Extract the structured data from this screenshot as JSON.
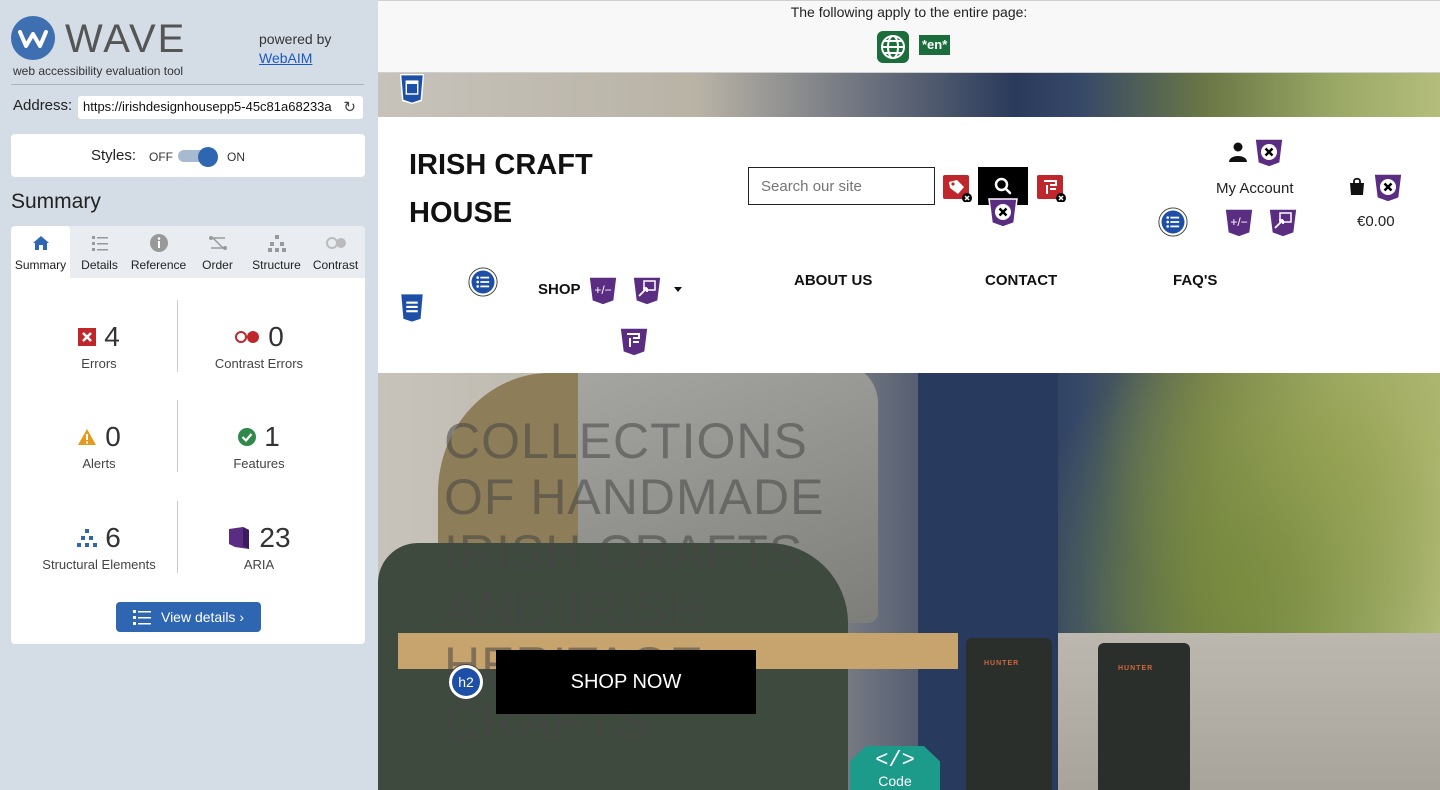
{
  "wave": {
    "logo_text": "WAVE",
    "tagline": "web accessibility evaluation tool",
    "powered_by": "powered by",
    "webaim_link": "WebAIM",
    "address_label": "Address:",
    "address_value": "https://irishdesignhousepp5-45c81a68233a",
    "styles_label": "Styles:",
    "styles_off": "OFF",
    "styles_on": "ON",
    "summary_title": "Summary",
    "tabs": [
      {
        "label": "Summary",
        "icon": "home-icon"
      },
      {
        "label": "Details",
        "icon": "list-icon"
      },
      {
        "label": "Reference",
        "icon": "info-icon"
      },
      {
        "label": "Order",
        "icon": "order-icon"
      },
      {
        "label": "Structure",
        "icon": "structure-icon"
      },
      {
        "label": "Contrast",
        "icon": "contrast-icon"
      }
    ],
    "stats": {
      "errors": {
        "value": "4",
        "label": "Errors"
      },
      "contrast_errors": {
        "value": "0",
        "label": "Contrast Errors"
      },
      "alerts": {
        "value": "0",
        "label": "Alerts"
      },
      "features": {
        "value": "1",
        "label": "Features"
      },
      "structural": {
        "value": "6",
        "label": "Structural Elements"
      },
      "aria": {
        "value": "23",
        "label": "ARIA"
      }
    },
    "view_details": "View details ›"
  },
  "site": {
    "banner_text": "The following apply to the entire page:",
    "lang_badge": "*en*",
    "brand_line1": "IRISH CRAFT",
    "brand_line2": "HOUSE",
    "search_placeholder": "Search our site",
    "account_label": "My Account",
    "cart_total": "€0.00",
    "nav": {
      "shop": "SHOP",
      "about": "ABOUT US",
      "contact": "CONTACT",
      "faq": "FAQ'S"
    },
    "hero_heading": "COLLECTIONS OF HANDMADE IRISH CRAFTS AND IRISH HERITAGE CRAFTS",
    "boot_brand": "HUNTER",
    "shop_now": "SHOP NOW",
    "h2_badge": "h2",
    "code_symbol": "</>",
    "code_label": "Code"
  },
  "colors": {
    "wave_blue": "#2f66b2",
    "error_red": "#c0272d",
    "aria_purple": "#5b2d82",
    "feature_green": "#1b6d3c",
    "code_teal": "#1c9a8a"
  }
}
